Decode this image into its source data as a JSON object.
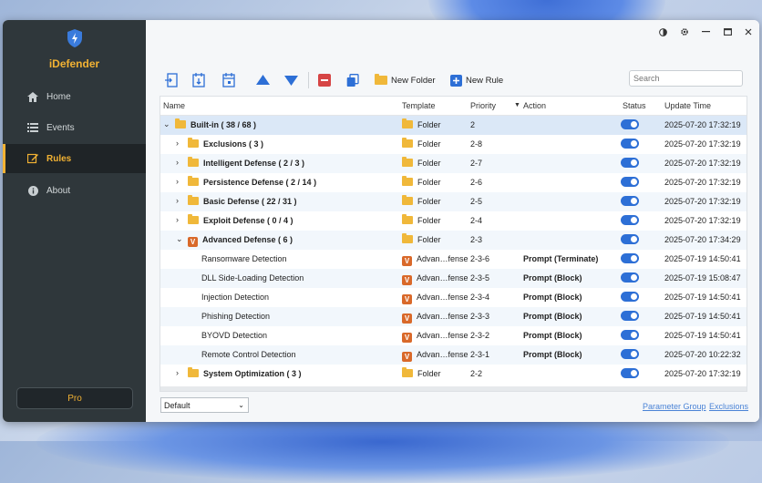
{
  "app": {
    "name": "iDefender"
  },
  "sidebar": {
    "items": [
      {
        "label": "Home",
        "icon": "home-icon"
      },
      {
        "label": "Events",
        "icon": "list-icon"
      },
      {
        "label": "Rules",
        "icon": "edit-icon",
        "active": true
      },
      {
        "label": "About",
        "icon": "info-icon"
      }
    ],
    "pro_label": "Pro"
  },
  "toolbar": {
    "new_folder_label": "New Folder",
    "new_rule_label": "New Rule",
    "search_placeholder": "Search"
  },
  "table": {
    "columns": {
      "name": "Name",
      "template": "Template",
      "priority": "Priority",
      "action": "Action",
      "status": "Status",
      "update_time": "Update Time"
    },
    "rows": [
      {
        "name": "Built-in ( 38 / 68 )",
        "template": "Folder",
        "priority": "2",
        "action": "",
        "update": "2025-07-20 17:32:19"
      },
      {
        "name": "Exclusions ( 3 )",
        "template": "Folder",
        "priority": "2-8",
        "action": "",
        "update": "2025-07-20 17:32:19"
      },
      {
        "name": "Intelligent Defense ( 2 / 3 )",
        "template": "Folder",
        "priority": "2-7",
        "action": "",
        "update": "2025-07-20 17:32:19"
      },
      {
        "name": "Persistence Defense ( 2 / 14 )",
        "template": "Folder",
        "priority": "2-6",
        "action": "",
        "update": "2025-07-20 17:32:19"
      },
      {
        "name": "Basic Defense ( 22 / 31 )",
        "template": "Folder",
        "priority": "2-5",
        "action": "",
        "update": "2025-07-20 17:32:19"
      },
      {
        "name": "Exploit Defense ( 0 / 4 )",
        "template": "Folder",
        "priority": "2-4",
        "action": "",
        "update": "2025-07-20 17:32:19"
      },
      {
        "name": "Advanced Defense ( 6 )",
        "template": "Folder",
        "priority": "2-3",
        "action": "",
        "update": "2025-07-20 17:34:29"
      },
      {
        "name": "Ransomware Detection",
        "template": "Advan…fense",
        "priority": "2-3-6",
        "action": "Prompt (Terminate)",
        "update": "2025-07-19 14:50:41"
      },
      {
        "name": "DLL Side-Loading Detection",
        "template": "Advan…fense",
        "priority": "2-3-5",
        "action": "Prompt (Block)",
        "update": "2025-07-19 15:08:47"
      },
      {
        "name": "Injection Detection",
        "template": "Advan…fense",
        "priority": "2-3-4",
        "action": "Prompt (Block)",
        "update": "2025-07-19 14:50:41"
      },
      {
        "name": "Phishing Detection",
        "template": "Advan…fense",
        "priority": "2-3-3",
        "action": "Prompt (Block)",
        "update": "2025-07-19 14:50:41"
      },
      {
        "name": "BYOVD Detection",
        "template": "Advan…fense",
        "priority": "2-3-2",
        "action": "Prompt (Block)",
        "update": "2025-07-19 14:50:41"
      },
      {
        "name": "Remote Control Detection",
        "template": "Advan…fense",
        "priority": "2-3-1",
        "action": "Prompt (Block)",
        "update": "2025-07-20 10:22:32"
      },
      {
        "name": "System Optimization ( 3 )",
        "template": "Folder",
        "priority": "2-2",
        "action": "",
        "update": "2025-07-20 17:32:19"
      }
    ]
  },
  "footer": {
    "profile_value": "Default",
    "parameter_group_label": "Parameter Group",
    "exclusions_label": "Exclusions"
  }
}
